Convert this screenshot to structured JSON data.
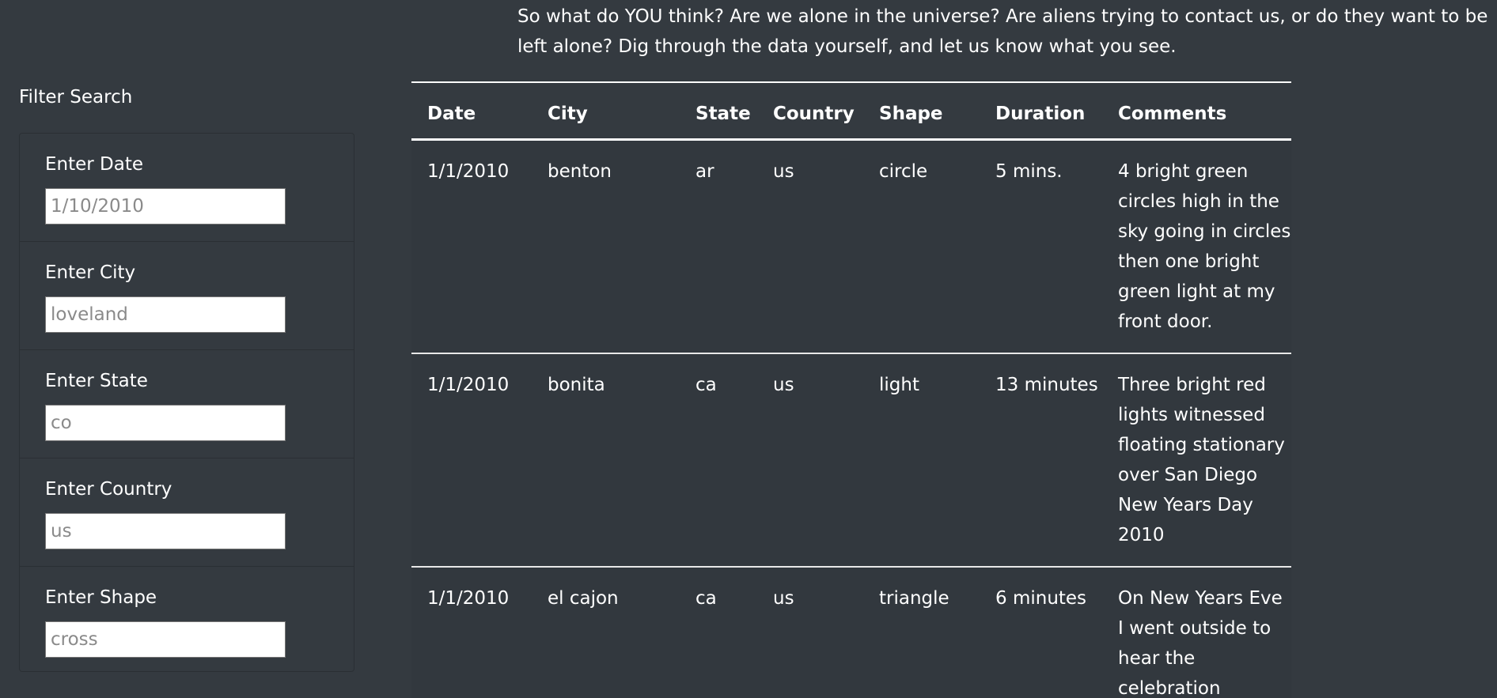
{
  "intro_text": "So what do YOU think? Are we alone in the universe? Are aliens trying to contact us, or do they want to be left alone? Dig through the data yourself, and let us know what you see.",
  "filters": {
    "title": "Filter Search",
    "items": [
      {
        "label": "Enter Date",
        "placeholder": "1/10/2010"
      },
      {
        "label": "Enter City",
        "placeholder": "loveland"
      },
      {
        "label": "Enter State",
        "placeholder": "co"
      },
      {
        "label": "Enter Country",
        "placeholder": "us"
      },
      {
        "label": "Enter Shape",
        "placeholder": "cross"
      }
    ]
  },
  "table": {
    "headers": [
      "Date",
      "City",
      "State",
      "Country",
      "Shape",
      "Duration",
      "Comments"
    ],
    "rows": [
      [
        "1/1/2010",
        "benton",
        "ar",
        "us",
        "circle",
        "5 mins.",
        "4 bright green circles high in the sky going in circles then one bright green light at my front door."
      ],
      [
        "1/1/2010",
        "bonita",
        "ca",
        "us",
        "light",
        "13 minutes",
        "Three bright red lights witnessed floating stationary over San Diego New Years Day 2010"
      ],
      [
        "1/1/2010",
        "el cajon",
        "ca",
        "us",
        "triangle",
        "6 minutes",
        "On New Years Eve I went outside to hear the celebration"
      ]
    ]
  },
  "colors": {
    "background": "#343a40",
    "text": "#ffffff"
  }
}
